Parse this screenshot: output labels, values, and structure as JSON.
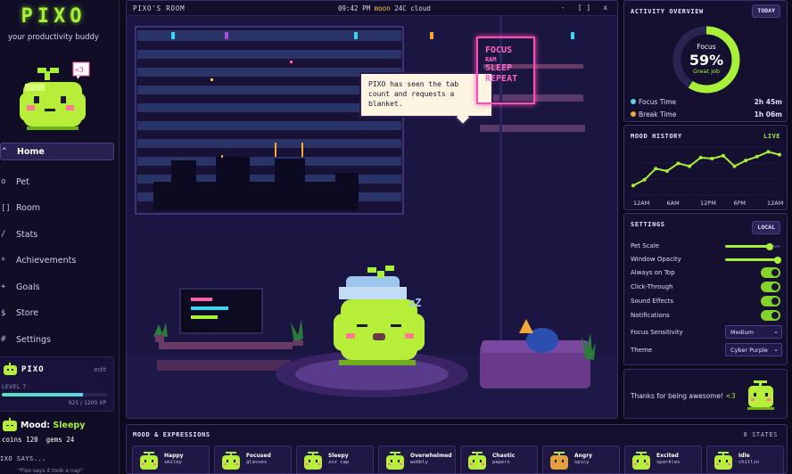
{
  "app": {
    "logo": "PIXO",
    "tagline": "your productivity buddy",
    "heart_bubble": "<3"
  },
  "nav": [
    {
      "label": "Home",
      "icon": "^",
      "active": true
    },
    {
      "label": "Pet",
      "icon": "o"
    },
    {
      "label": "Room",
      "icon": "[]"
    },
    {
      "label": "Stats",
      "icon": "/"
    },
    {
      "label": "Achievements",
      "icon": "*"
    },
    {
      "label": "Goals",
      "icon": "+"
    },
    {
      "label": "Store",
      "icon": "$"
    },
    {
      "label": "Settings",
      "icon": "#"
    }
  ],
  "pet_card": {
    "name": "PIXO",
    "edit": "edit",
    "level": "LEVEL 7",
    "xp_text": "925 / 1200 XP",
    "xp_fraction": 0.77
  },
  "mood": {
    "label": "Mood:",
    "value": "Sleepy",
    "coins": "coins 120",
    "gems": "gems 24"
  },
  "pixo_says": {
    "title": "IXO SAYS...",
    "line": "\"Pixo says it took a nap\""
  },
  "room": {
    "title": "PIXO'S ROOM",
    "time": "09:42 PM",
    "weather_icon": "moon",
    "weather": "24C cloud",
    "controls": "- [] x",
    "speech": "PIXO has seen the tab count and requests a blanket.",
    "neon_sign": [
      "FOCUS",
      "RAM",
      "SLEEP",
      "REPEAT"
    ],
    "sleep_z": "zZ"
  },
  "activity": {
    "title": "ACTIVITY OVERVIEW",
    "button": "TODAY",
    "focus_label": "Focus",
    "percent": "59%",
    "percent_value": 59,
    "caption": "Great job",
    "rows": [
      {
        "label": "Focus Time",
        "value": "2h 45m",
        "color": "#5ad6e6"
      },
      {
        "label": "Break Time",
        "value": "1h 06m",
        "color": "#f2a93a"
      }
    ],
    "accent": "#a8f03a"
  },
  "mood_history": {
    "title": "MOOD HISTORY",
    "live": "LIVE",
    "chart_data": {
      "type": "line",
      "categories": [
        "12AM",
        "6AM",
        "12PM",
        "6PM",
        "12AM"
      ],
      "values": [
        20,
        32,
        55,
        50,
        66,
        60,
        78,
        76,
        82,
        60,
        72,
        80,
        90,
        84
      ],
      "ylim": [
        0,
        100
      ],
      "color": "#a8f03a"
    }
  },
  "settings": {
    "title": "SETTINGS",
    "button": "LOCAL",
    "sliders": [
      {
        "label": "Pet Scale",
        "value": 0.8
      },
      {
        "label": "Window Opacity",
        "value": 0.95
      }
    ],
    "toggles": [
      {
        "label": "Always on Top",
        "on": true
      },
      {
        "label": "Click-Through",
        "on": true
      },
      {
        "label": "Sound Effects",
        "on": true
      },
      {
        "label": "Notifications",
        "on": true
      }
    ],
    "selects": [
      {
        "label": "Focus Sensitivity",
        "value": "Medium"
      },
      {
        "label": "Theme",
        "value": "Cyber Purple"
      }
    ]
  },
  "thanks": {
    "text": "Thanks for being awesome!",
    "heart": "<3"
  },
  "expressions": {
    "title": "MOOD & EXPRESSIONS",
    "count": "8 STATES",
    "items": [
      {
        "name": "Happy",
        "desc": "smiley",
        "icon": "happy-pet-icon"
      },
      {
        "name": "Focused",
        "desc": "glasses",
        "icon": "focused-pet-icon"
      },
      {
        "name": "Sleepy",
        "desc": "zzz cap",
        "icon": "sleepy-pet-icon"
      },
      {
        "name": "Overwhelmed",
        "desc": "wobbly",
        "icon": "overwhelmed-pet-icon"
      },
      {
        "name": "Chaotic",
        "desc": "papers",
        "icon": "chaotic-pet-icon"
      },
      {
        "name": "Angry",
        "desc": "spicy",
        "icon": "angry-pet-icon"
      },
      {
        "name": "Excited",
        "desc": "sparkles",
        "icon": "excited-pet-icon"
      },
      {
        "name": "Idle",
        "desc": "chillin",
        "icon": "idle-pet-icon"
      }
    ]
  }
}
